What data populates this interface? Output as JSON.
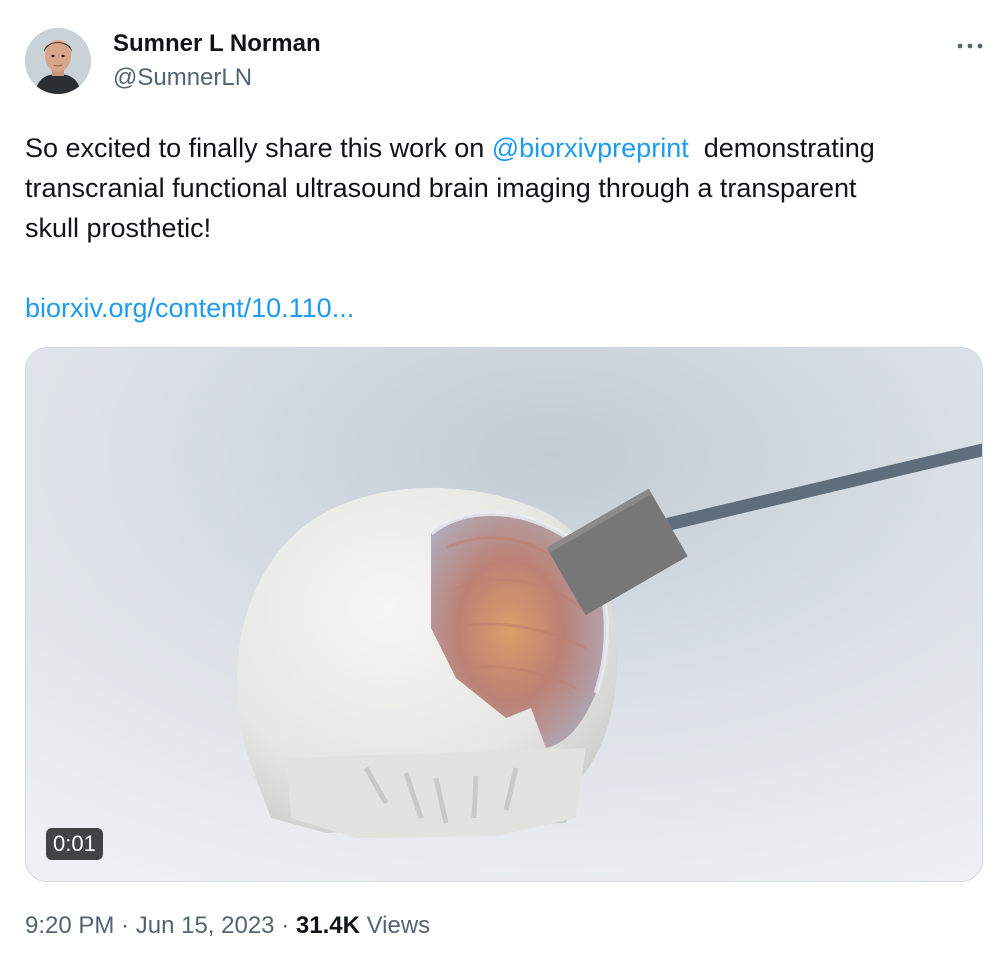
{
  "author": {
    "display_name": "Sumner L Norman",
    "handle": "@SumnerLN"
  },
  "more_icon": "more-horizontal-icon",
  "tweet": {
    "text_part1": "So excited to finally share this work on ",
    "mention": "@biorxivpreprint",
    "text_part2": "  demonstrating",
    "line2": "transcranial functional ultrasound brain imaging through a transparent",
    "line3": "skull prosthetic!",
    "link": "biorxiv.org/content/10.110..."
  },
  "media": {
    "type": "video",
    "duration": "0:01"
  },
  "meta": {
    "time": "9:20 PM",
    "separator": "·",
    "date": "Jun 15, 2023",
    "views_count": "31.4K",
    "views_label": "Views"
  },
  "colors": {
    "link": "#1d9bf0",
    "text": "#0f1419",
    "secondary": "#536471"
  }
}
